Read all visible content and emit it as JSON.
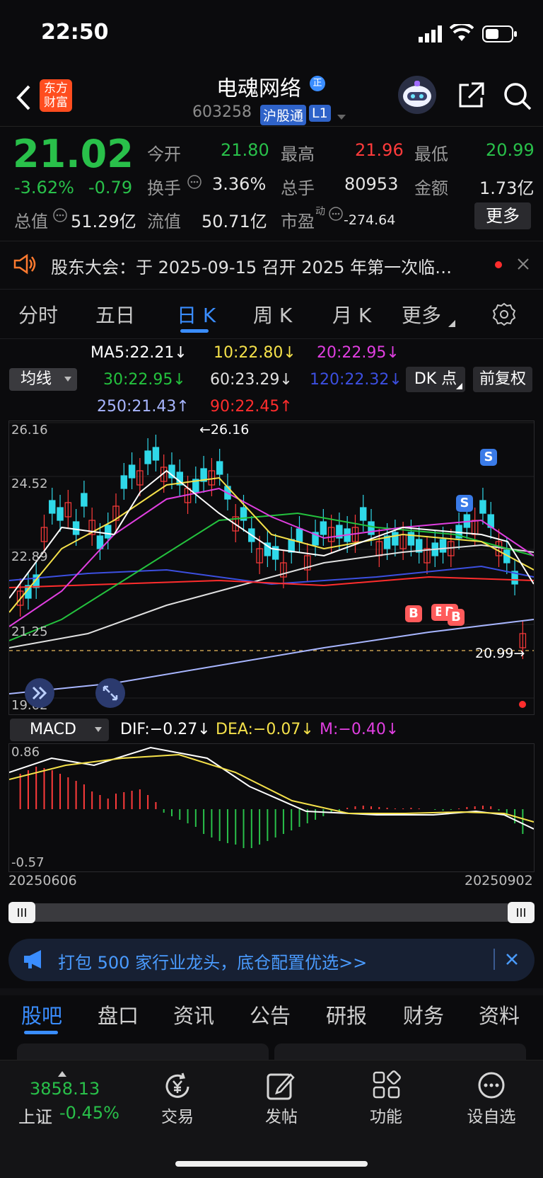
{
  "status_bar": {
    "time": "22:50"
  },
  "header": {
    "app_logo": "东方\n财富",
    "stock_name": "电魂网络",
    "name_badge": "正",
    "code": "603258",
    "tag": "沪股通",
    "level": "L1"
  },
  "quote": {
    "price": "21.02",
    "change_pct": "-3.62%",
    "change": "-0.79",
    "open_label": "今开",
    "open": "21.80",
    "high_label": "最高",
    "high": "21.96",
    "low_label": "最低",
    "low": "20.99",
    "turnover_label": "换手",
    "turnover": "3.36%",
    "volume_label": "总手",
    "volume": "80953",
    "amount_label": "金额",
    "amount": "1.73亿",
    "mktcap_label": "总值",
    "mktcap": "51.29亿",
    "float_label": "流值",
    "float": "50.71亿",
    "pe_label": "市盈",
    "pe_sup": "动",
    "pe": "-274.64",
    "more_button": "更多"
  },
  "notice": {
    "text": "股东大会：于 2025-09-15 召开 2025 年第一次临…"
  },
  "chart_tabs": [
    "分时",
    "五日",
    "日 K",
    "周 K",
    "月 K",
    "更多"
  ],
  "ma": {
    "selector": "均线",
    "ma5": "MA5:22.21↓",
    "ma10": "10:22.80↓",
    "ma20": "20:22.95↓",
    "ma30": "30:22.95↓",
    "ma60": "60:23.29↓",
    "ma120": "120:22.32↓",
    "ma250": "250:21.43↑",
    "ma90": "90:22.45↑",
    "dk_button": "DK 点",
    "adjust_button": "前复权"
  },
  "price_axis": [
    "26.16",
    "24.52",
    "22.89",
    "21.25",
    "19.62"
  ],
  "annotations": {
    "high_mark": "←26.16",
    "low_mark": "20.99→",
    "buy": "B",
    "sell": "S"
  },
  "macd": {
    "selector": "MACD",
    "dif": "DIF:−0.27↓",
    "dea": "DEA:−0.07↓",
    "m": "M:−0.40↓",
    "axis_top": "0.86",
    "axis_bottom": "-0.57"
  },
  "date_range": {
    "start": "20250606",
    "end": "20250902"
  },
  "promo": {
    "text": "打包 500 家行业龙头，底仓配置优选>>"
  },
  "bottom_tabs": [
    "股吧",
    "盘口",
    "资讯",
    "公告",
    "研报",
    "财务",
    "资料"
  ],
  "bottom_nav": {
    "index_value": "3858.13",
    "index_name": "上证",
    "index_change": "-0.45%",
    "items": [
      "交易",
      "发帖",
      "功能",
      "设自选"
    ]
  },
  "colors": {
    "up": "#ff3b3b",
    "down": "#29c04a",
    "accent": "#3a8dff",
    "candle_down": "#2fd8e8"
  }
}
